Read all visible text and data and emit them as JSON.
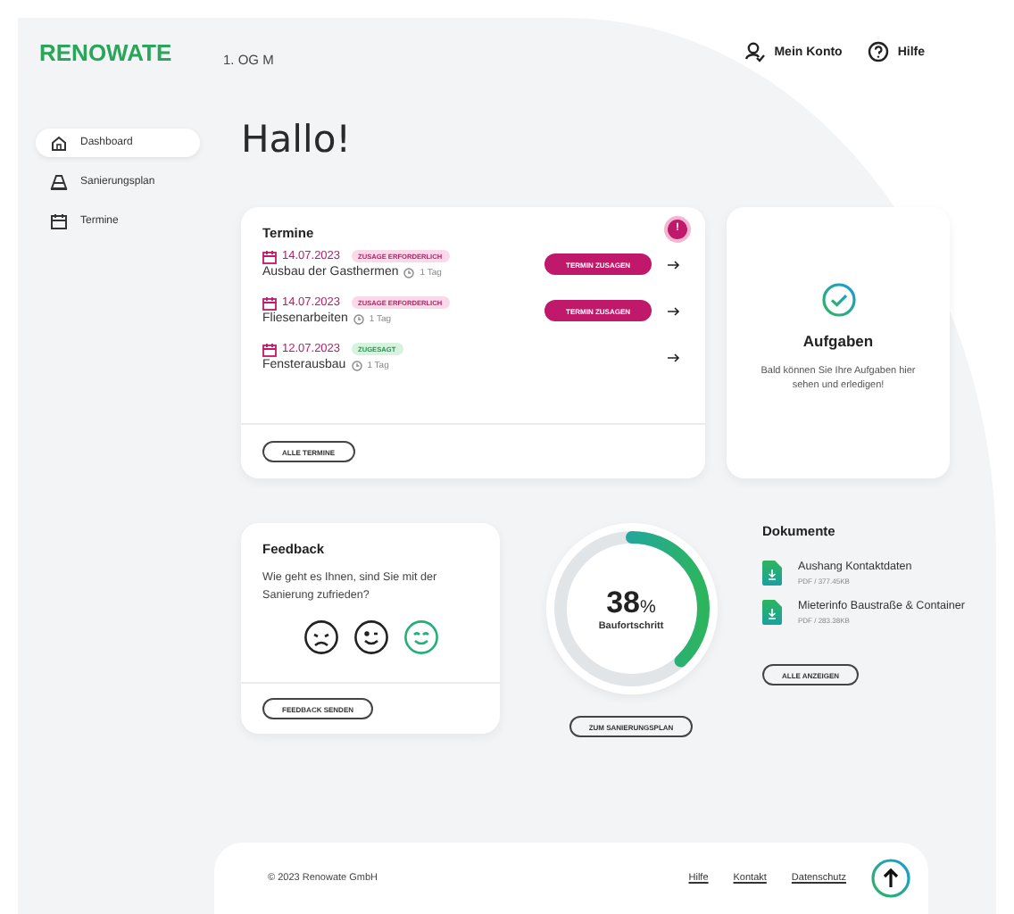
{
  "logo": "RENOWATE",
  "location": "1. OG M",
  "header_links": [
    {
      "label": "Mein Konto",
      "kind": "account"
    },
    {
      "label": "Hilfe",
      "kind": "help"
    }
  ],
  "sidebar": {
    "items": [
      {
        "label": "Dashboard",
        "kind": "home",
        "selected": true
      },
      {
        "label": "Sanierungsplan",
        "kind": "plan",
        "selected": false
      },
      {
        "label": "Termine",
        "kind": "calendar",
        "selected": false
      }
    ]
  },
  "greeting": "Hallo!",
  "appointments": {
    "title": "Termine",
    "badge": "!",
    "button": "ALLE TERMINE",
    "items": [
      {
        "date": "14.07.2023",
        "status": "ZUSAGE ERFORDERLICH",
        "kind": "pending",
        "name": "Ausbau der Gasthermen",
        "duration": "1 Tag",
        "action": "TERMIN ZUSAGEN"
      },
      {
        "date": "14.07.2023",
        "status": "ZUSAGE ERFORDERLICH",
        "kind": "pending",
        "name": "Fliesenarbeiten",
        "duration": "1 Tag",
        "action": "TERMIN ZUSAGEN"
      },
      {
        "date": "12.07.2023",
        "status": "ZUGESAGT",
        "kind": "confirmed",
        "name": "Fensterausbau",
        "duration": "1 Tag"
      }
    ]
  },
  "tasks": {
    "title": "Aufgaben",
    "text": "Bald können Sie Ihre Aufgaben hier sehen und erledigen!"
  },
  "feedback": {
    "title": "Feedback",
    "question": "Wie geht es Ihnen, sind Sie mit der Sanierung zufrieden?",
    "button": "FEEDBACK SENDEN",
    "moods": [
      {
        "kind": "sad",
        "selected": false
      },
      {
        "kind": "wink",
        "selected": false
      },
      {
        "kind": "happy",
        "selected": true
      }
    ]
  },
  "progress": {
    "level": 0.38,
    "percent": "38",
    "unit": "%",
    "label": "Baufortschritt",
    "button": "ZUM SANIERUNGSPLAN"
  },
  "documents": {
    "title": "Dokumente",
    "button": "ALLE ANZEIGEN",
    "items": [
      {
        "name": "Aushang Kontaktdaten",
        "meta": "PDF / 377.45KB"
      },
      {
        "name": "Mieterinfo Baustraße & Container",
        "meta": "PDF / 283.38KB"
      }
    ]
  },
  "footer": {
    "copyright": "© 2023 Renowate GmbH",
    "links": [
      "Hilfe",
      "Kontakt",
      "Datenschutz"
    ]
  }
}
